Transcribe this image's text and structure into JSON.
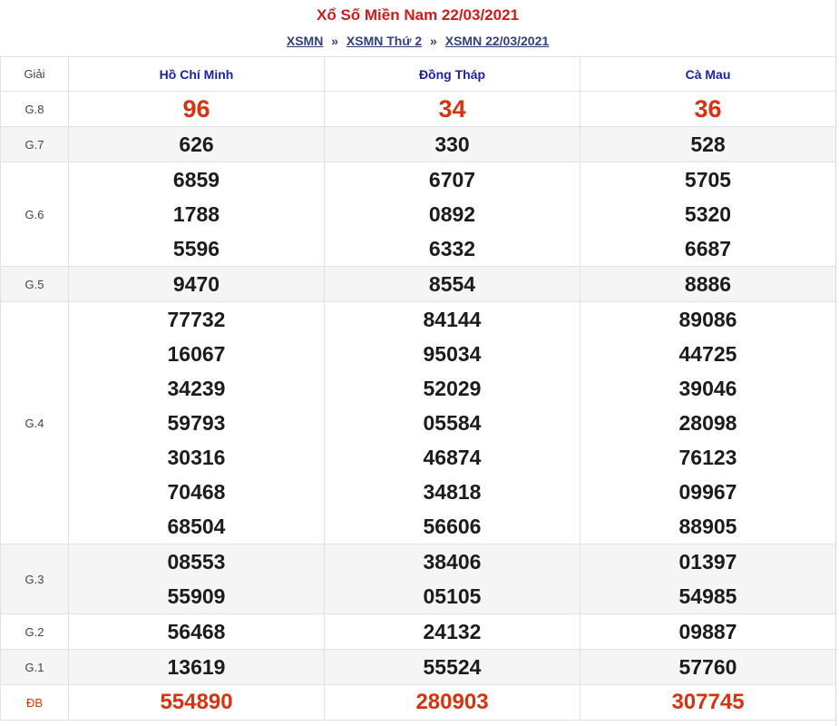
{
  "header": {
    "title": "Xổ Số Miền Nam 22/03/2021",
    "breadcrumb": [
      {
        "label": "XSMN"
      },
      {
        "label": "XSMN Thứ 2"
      },
      {
        "label": "XSMN 22/03/2021"
      }
    ],
    "separator": "»"
  },
  "table": {
    "prize_header": "Giải",
    "provinces": [
      "Hồ Chí Minh",
      "Đồng Tháp",
      "Cà Mau"
    ],
    "rows": [
      {
        "prize": "G.8",
        "values": [
          [
            "96"
          ],
          [
            "34"
          ],
          [
            "36"
          ]
        ]
      },
      {
        "prize": "G.7",
        "values": [
          [
            "626"
          ],
          [
            "330"
          ],
          [
            "528"
          ]
        ]
      },
      {
        "prize": "G.6",
        "values": [
          [
            "6859",
            "1788",
            "5596"
          ],
          [
            "6707",
            "0892",
            "6332"
          ],
          [
            "5705",
            "5320",
            "6687"
          ]
        ]
      },
      {
        "prize": "G.5",
        "values": [
          [
            "9470"
          ],
          [
            "8554"
          ],
          [
            "8886"
          ]
        ]
      },
      {
        "prize": "G.4",
        "values": [
          [
            "77732",
            "16067",
            "34239",
            "59793",
            "30316",
            "70468",
            "68504"
          ],
          [
            "84144",
            "95034",
            "52029",
            "05584",
            "46874",
            "34818",
            "56606"
          ],
          [
            "89086",
            "44725",
            "39046",
            "28098",
            "76123",
            "09967",
            "88905"
          ]
        ]
      },
      {
        "prize": "G.3",
        "values": [
          [
            "08553",
            "55909"
          ],
          [
            "38406",
            "05105"
          ],
          [
            "01397",
            "54985"
          ]
        ]
      },
      {
        "prize": "G.2",
        "values": [
          [
            "56468"
          ],
          [
            "24132"
          ],
          [
            "09887"
          ]
        ]
      },
      {
        "prize": "G.1",
        "values": [
          [
            "13619"
          ],
          [
            "55524"
          ],
          [
            "57760"
          ]
        ]
      },
      {
        "prize": "ĐB",
        "values": [
          [
            "554890"
          ],
          [
            "280903"
          ],
          [
            "307745"
          ]
        ]
      }
    ]
  },
  "colors": {
    "title_red": "#d31a1a",
    "breadcrumb_navy": "#33417a",
    "province_blue": "#1d21a8",
    "highlight_orange_red": "#d8330e",
    "alt_row_gray": "#f5f5f5"
  }
}
